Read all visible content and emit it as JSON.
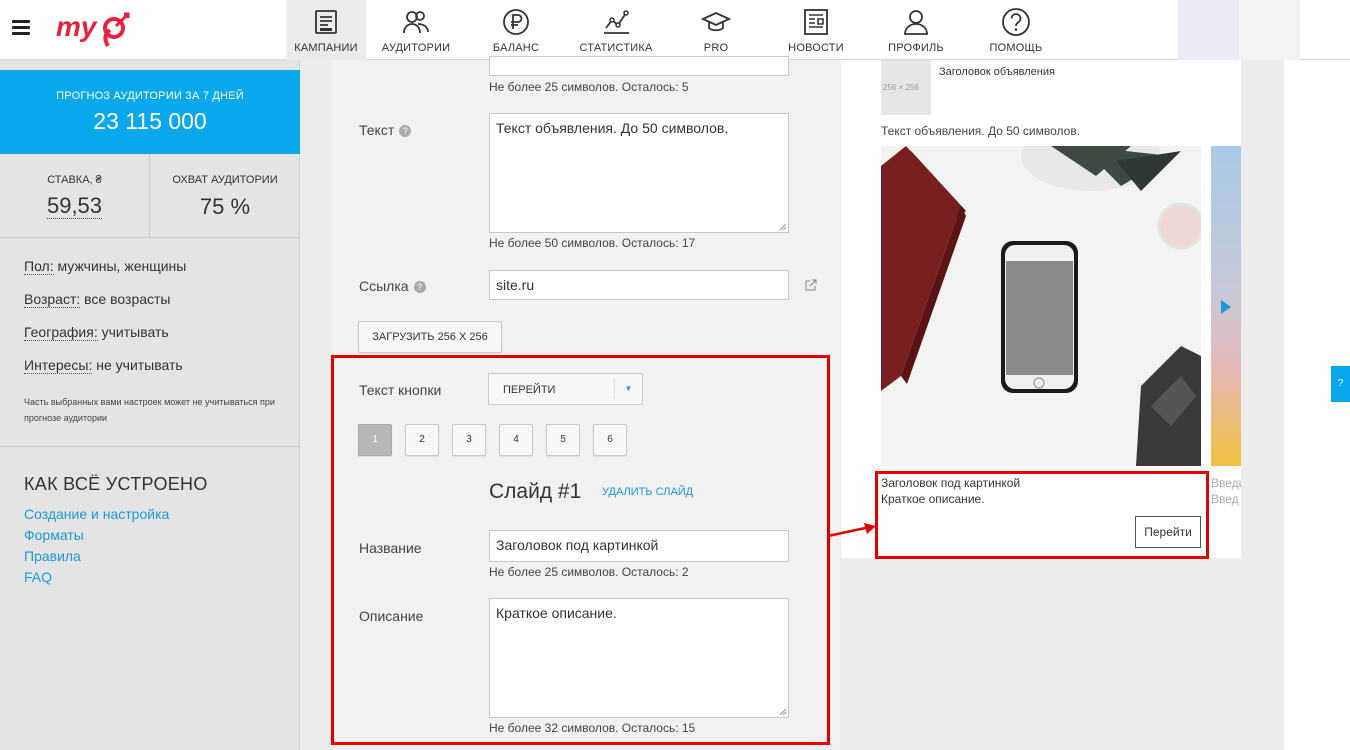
{
  "brand": {
    "logo_text": "my",
    "accent": "#09a8ec",
    "logo_color": "#e8213e",
    "highlight": "#e00000"
  },
  "nav": [
    {
      "label": "КАМПАНИИ",
      "icon": "campaigns-icon",
      "active": true
    },
    {
      "label": "АУДИТОРИИ",
      "icon": "audiences-icon"
    },
    {
      "label": "БАЛАНС",
      "icon": "ruble-icon"
    },
    {
      "label": "СТАТИСТИКА",
      "icon": "chart-icon"
    },
    {
      "label": "PRO",
      "icon": "graduation-cap-icon"
    },
    {
      "label": "НОВОСТИ",
      "icon": "news-icon"
    },
    {
      "label": "ПРОФИЛЬ",
      "icon": "user-icon"
    },
    {
      "label": "ПОМОЩЬ",
      "icon": "help-icon"
    }
  ],
  "sidebar": {
    "forecast": {
      "title": "ПРОГНОЗ АУДИТОРИИ ЗА 7 ДНЕЙ",
      "value": "23 115 000"
    },
    "bid": {
      "title": "СТАВКА, ₴",
      "value": "59,53"
    },
    "reach": {
      "title": "ОХВАТ АУДИТОРИИ",
      "value": "75 %"
    },
    "params": [
      {
        "key": "Пол:",
        "value": " мужчины, женщины"
      },
      {
        "key": "Возраст:",
        "value": " все возрасты"
      },
      {
        "key": "География:",
        "value": " учитывать"
      },
      {
        "key": "Интересы:",
        "value": " не учитывать"
      }
    ],
    "note": "Часть выбранных вами настроек может не учитываться при прогнозе аудитории",
    "how_title": "КАК ВСЁ УСТРОЕНО",
    "links": [
      "Создание и настройка",
      "Форматы",
      "Правила",
      "FAQ"
    ]
  },
  "form": {
    "title_hint": "Не более  25  символов. Осталось: 5",
    "text_label": "Текст",
    "text_value": "Текст объявления. До 50 символов.",
    "text_hint": "Не более  50  символов. Осталось: 17",
    "link_label": "Ссылка",
    "link_value": "site.ru",
    "upload_label": "ЗАГРУЗИТЬ 256 X 256",
    "button_text_label": "Текст кнопки",
    "button_text_value": "ПЕРЕЙТИ",
    "slides": [
      "1",
      "2",
      "3",
      "4",
      "5",
      "6"
    ],
    "slide_title": "Слайд #1",
    "delete_slide": "УДАЛИТЬ СЛАЙД",
    "name_label": "Название",
    "name_value": "Заголовок под картинкой",
    "name_hint": "Не более  25  символов. Осталось: 2",
    "desc_label": "Описание",
    "desc_value": "Краткое описание.",
    "desc_hint": "Не более  32  символов. Осталось: 15"
  },
  "preview": {
    "thumb_size": "256 × 256",
    "headline": "Заголовок объявления",
    "text": "Текст объявления. До 50 символов.",
    "caption_title": "Заголовок под картинкой",
    "caption_desc": "Краткое описание.",
    "button": "Перейти",
    "next_title": "Введи",
    "next_desc": "Введ"
  },
  "help_tab": "?"
}
